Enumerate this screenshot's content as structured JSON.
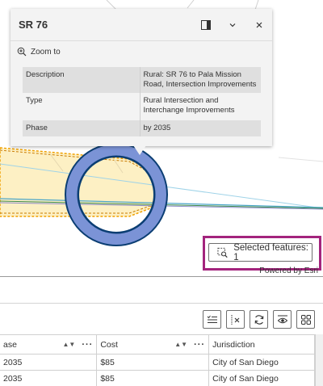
{
  "popup": {
    "title": "SR 76",
    "actions": [
      "dock-icon",
      "chevron-down-icon",
      "close-icon"
    ],
    "zoom_to_label": "Zoom to",
    "attributes": [
      {
        "key": "Description",
        "value": "Rural: SR 76 to Pala Mission Road, Intersection Improvements"
      },
      {
        "key": "Type",
        "value": "Rural Intersection and Interchange Improvements"
      },
      {
        "key": "Phase",
        "value": "by 2035"
      }
    ]
  },
  "map": {
    "selected_features_label": "Selected features: 1",
    "attribution": "Powered by Esri",
    "colors": {
      "road_fill": "#fdf0c4",
      "road_outline": "#f0a000",
      "selection_ring": "#7b93d6",
      "selection_outline": "#0b3e73",
      "highlight_box": "#a3247d"
    }
  },
  "table": {
    "toolbar": [
      "show-selected-icon",
      "clear-selection-icon",
      "refresh-icon",
      "toggle-columns-icon",
      "layout-icon"
    ],
    "columns": [
      {
        "label": "ase"
      },
      {
        "label": "Cost"
      },
      {
        "label": "Jurisdiction"
      }
    ],
    "rows": [
      [
        "2035",
        "$85",
        "City of San Diego"
      ],
      [
        "2035",
        "$85",
        "City of San Diego"
      ]
    ]
  }
}
